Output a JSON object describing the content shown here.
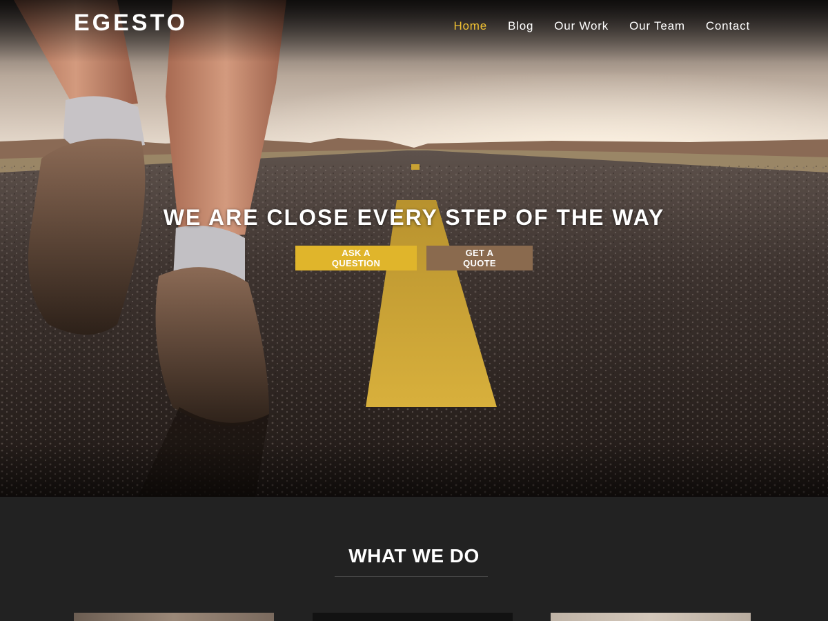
{
  "brand": {
    "logo": "EGESTO"
  },
  "nav": {
    "items": [
      {
        "label": "Home",
        "active": true
      },
      {
        "label": "Blog",
        "active": false
      },
      {
        "label": "Our Work",
        "active": false
      },
      {
        "label": "Our Team",
        "active": false
      },
      {
        "label": "Contact",
        "active": false
      }
    ]
  },
  "hero": {
    "headline": "WE ARE CLOSE EVERY STEP OF THE WAY",
    "ask_button": "ASK A QUESTION",
    "quote_button": "GET A QUOTE"
  },
  "services": {
    "title": "WHAT WE DO"
  },
  "colors": {
    "accent": "#f1c232",
    "button_primary": "#e0b52b",
    "button_secondary": "#8a6a4e",
    "section_bg": "#222222"
  }
}
